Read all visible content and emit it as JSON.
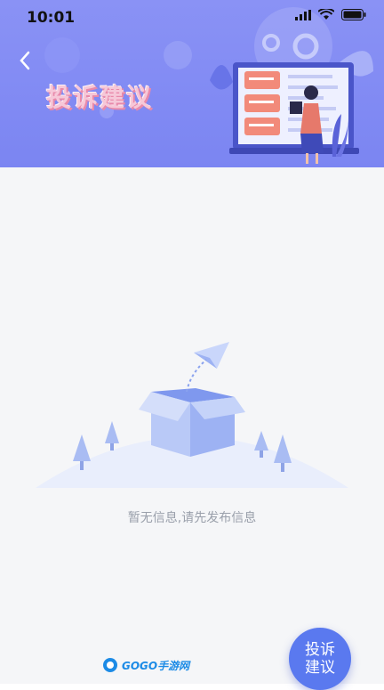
{
  "status_bar": {
    "time": "10:01"
  },
  "header": {
    "title": "投诉建议"
  },
  "empty_state": {
    "message": "暂无信息,请先发布信息"
  },
  "fab": {
    "line1": "投诉",
    "line2": "建议"
  },
  "watermark": {
    "text": "GOGO手游网"
  },
  "colors": {
    "header": "#7b85f2",
    "accent": "#5a79ef",
    "title_pink": "#f6c8d8"
  }
}
